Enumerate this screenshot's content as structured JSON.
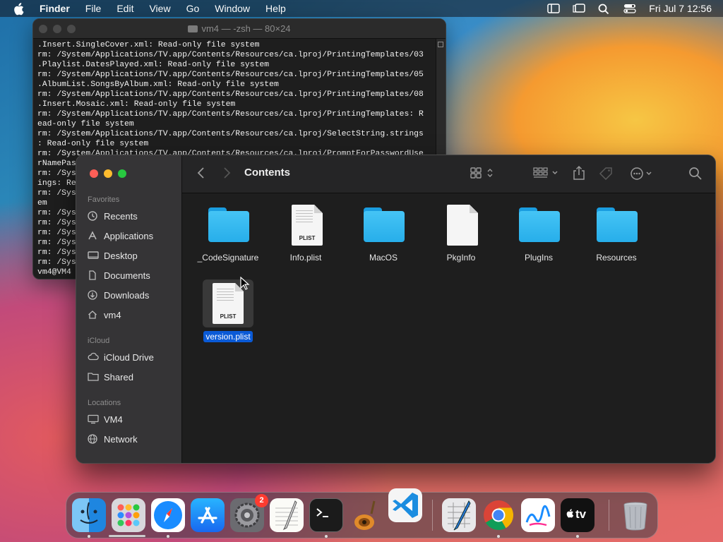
{
  "menubar": {
    "app_name": "Finder",
    "items": [
      "File",
      "Edit",
      "View",
      "Go",
      "Window",
      "Help"
    ],
    "clock": "Fri Jul 7  12:56"
  },
  "terminal": {
    "title": "vm4 — -zsh — 80×24",
    "lines": [
      ".Insert.SingleCover.xml: Read-only file system",
      "rm: /System/Applications/TV.app/Contents/Resources/ca.lproj/PrintingTemplates/03",
      ".Playlist.DatesPlayed.xml: Read-only file system",
      "rm: /System/Applications/TV.app/Contents/Resources/ca.lproj/PrintingTemplates/05",
      ".AlbumList.SongsByAlbum.xml: Read-only file system",
      "rm: /System/Applications/TV.app/Contents/Resources/ca.lproj/PrintingTemplates/08",
      ".Insert.Mosaic.xml: Read-only file system",
      "rm: /System/Applications/TV.app/Contents/Resources/ca.lproj/PrintingTemplates: R",
      "ead-only file system",
      "rm: /System/Applications/TV.app/Contents/Resources/ca.lproj/SelectString.strings",
      ": Read-only file system",
      "rm: /System/Applications/TV.app/Contents/Resources/ca.lproj/PromptForPasswordUse",
      "rNamePas",
      "rm: /Sys",
      "ings: Re",
      "rm: /Sys",
      "em",
      "rm: /Sys",
      "rm: /Sys",
      "rm: /Sys",
      "rm: /Sys",
      "rm: /Sys",
      "rm: /Sys",
      "vm4@VM4"
    ]
  },
  "finder": {
    "path_title": "Contents",
    "sidebar": {
      "favorites_header": "Favorites",
      "favorites": [
        "Recents",
        "Applications",
        "Desktop",
        "Documents",
        "Downloads",
        "vm4"
      ],
      "icloud_header": "iCloud",
      "icloud": [
        "iCloud Drive",
        "Shared"
      ],
      "locations_header": "Locations",
      "locations": [
        "VM4",
        "Network"
      ]
    },
    "files": [
      {
        "name": "_CodeSignature",
        "kind": "folder"
      },
      {
        "name": "Info.plist",
        "kind": "plist",
        "badge": "PLIST"
      },
      {
        "name": "MacOS",
        "kind": "folder"
      },
      {
        "name": "PkgInfo",
        "kind": "doc"
      },
      {
        "name": "PlugIns",
        "kind": "folder"
      },
      {
        "name": "Resources",
        "kind": "folder"
      },
      {
        "name": "version.plist",
        "kind": "plist",
        "badge": "PLIST",
        "selected": true
      }
    ]
  },
  "dock": {
    "apps": [
      "finder-icon",
      "launchpad-icon",
      "safari-icon",
      "app-store-icon",
      "system-settings-icon",
      "textedit-icon",
      "terminal-icon",
      "garageband-icon",
      "vscode-icon",
      "xcode-instruments-icon",
      "chrome-icon",
      "freeform-icon",
      "apple-tv-icon",
      "trash-icon"
    ],
    "settings_badge": "2",
    "tv_label": "tv"
  }
}
